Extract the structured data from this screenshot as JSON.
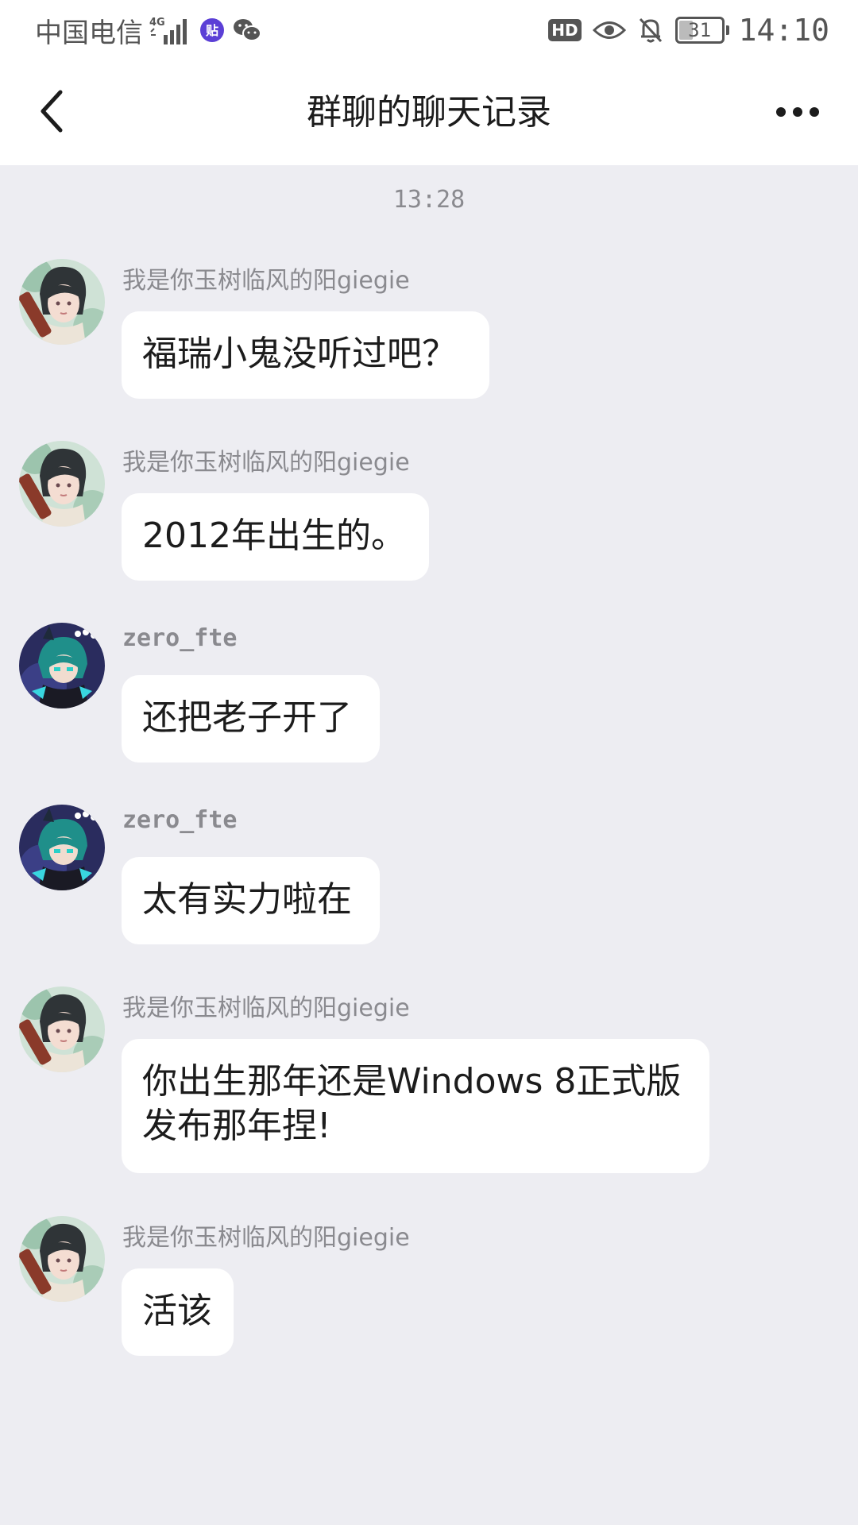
{
  "status_bar": {
    "carrier": "中国电信",
    "network": "4G",
    "hd_label": "HD",
    "battery_level": "31",
    "time": "14:10",
    "icons": [
      "signal-icon",
      "tieba-icon",
      "wechat-icon",
      "hd-icon",
      "eye-icon",
      "mute-bell-icon",
      "battery-icon"
    ]
  },
  "nav": {
    "title": "群聊的聊天记录",
    "back_icon": "chevron-left-icon",
    "more_icon": "more-dots-icon"
  },
  "chat": {
    "timestamp": "13:28",
    "messages": [
      {
        "sender": "我是你玉树临风的阳giegie",
        "avatar": "avatar-yang",
        "text": "福瑞小鬼没听过吧？"
      },
      {
        "sender": "我是你玉树临风的阳giegie",
        "avatar": "avatar-yang",
        "text": "2012年出生的。"
      },
      {
        "sender": "zero_fte",
        "avatar": "avatar-zero",
        "text": "还把老子开了"
      },
      {
        "sender": "zero_fte",
        "avatar": "avatar-zero",
        "text": "太有实力啦在"
      },
      {
        "sender": "我是你玉树临风的阳giegie",
        "avatar": "avatar-yang",
        "text": "你出生那年还是Windows 8正式版发布那年捏!"
      },
      {
        "sender": "我是你玉树临风的阳giegie",
        "avatar": "avatar-yang",
        "text": "活该"
      }
    ]
  },
  "colors": {
    "background": "#ededf2",
    "bubble": "#ffffff",
    "secondary_text": "#8a8a8f"
  }
}
